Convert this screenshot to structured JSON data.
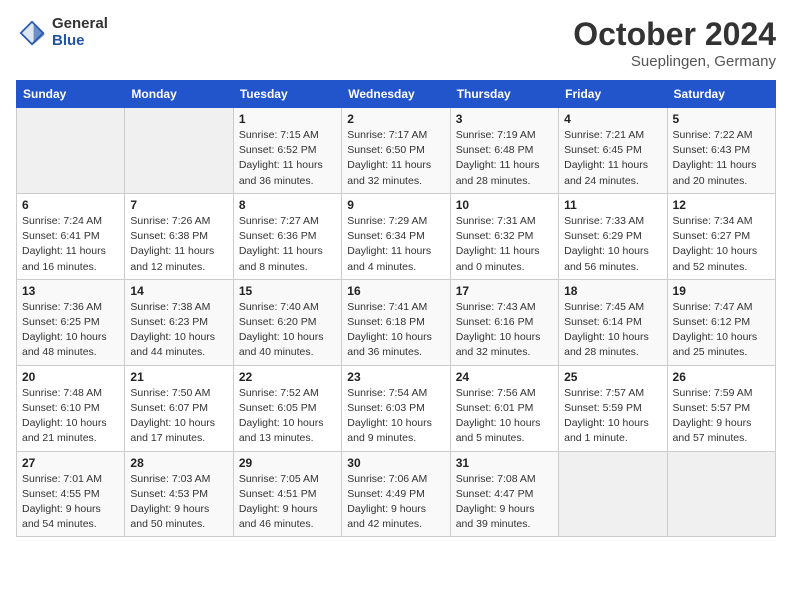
{
  "header": {
    "logo_general": "General",
    "logo_blue": "Blue",
    "month": "October 2024",
    "location": "Sueplingen, Germany"
  },
  "weekdays": [
    "Sunday",
    "Monday",
    "Tuesday",
    "Wednesday",
    "Thursday",
    "Friday",
    "Saturday"
  ],
  "weeks": [
    [
      {
        "day": "",
        "info": ""
      },
      {
        "day": "",
        "info": ""
      },
      {
        "day": "1",
        "info": "Sunrise: 7:15 AM\nSunset: 6:52 PM\nDaylight: 11 hours\nand 36 minutes."
      },
      {
        "day": "2",
        "info": "Sunrise: 7:17 AM\nSunset: 6:50 PM\nDaylight: 11 hours\nand 32 minutes."
      },
      {
        "day": "3",
        "info": "Sunrise: 7:19 AM\nSunset: 6:48 PM\nDaylight: 11 hours\nand 28 minutes."
      },
      {
        "day": "4",
        "info": "Sunrise: 7:21 AM\nSunset: 6:45 PM\nDaylight: 11 hours\nand 24 minutes."
      },
      {
        "day": "5",
        "info": "Sunrise: 7:22 AM\nSunset: 6:43 PM\nDaylight: 11 hours\nand 20 minutes."
      }
    ],
    [
      {
        "day": "6",
        "info": "Sunrise: 7:24 AM\nSunset: 6:41 PM\nDaylight: 11 hours\nand 16 minutes."
      },
      {
        "day": "7",
        "info": "Sunrise: 7:26 AM\nSunset: 6:38 PM\nDaylight: 11 hours\nand 12 minutes."
      },
      {
        "day": "8",
        "info": "Sunrise: 7:27 AM\nSunset: 6:36 PM\nDaylight: 11 hours\nand 8 minutes."
      },
      {
        "day": "9",
        "info": "Sunrise: 7:29 AM\nSunset: 6:34 PM\nDaylight: 11 hours\nand 4 minutes."
      },
      {
        "day": "10",
        "info": "Sunrise: 7:31 AM\nSunset: 6:32 PM\nDaylight: 11 hours\nand 0 minutes."
      },
      {
        "day": "11",
        "info": "Sunrise: 7:33 AM\nSunset: 6:29 PM\nDaylight: 10 hours\nand 56 minutes."
      },
      {
        "day": "12",
        "info": "Sunrise: 7:34 AM\nSunset: 6:27 PM\nDaylight: 10 hours\nand 52 minutes."
      }
    ],
    [
      {
        "day": "13",
        "info": "Sunrise: 7:36 AM\nSunset: 6:25 PM\nDaylight: 10 hours\nand 48 minutes."
      },
      {
        "day": "14",
        "info": "Sunrise: 7:38 AM\nSunset: 6:23 PM\nDaylight: 10 hours\nand 44 minutes."
      },
      {
        "day": "15",
        "info": "Sunrise: 7:40 AM\nSunset: 6:20 PM\nDaylight: 10 hours\nand 40 minutes."
      },
      {
        "day": "16",
        "info": "Sunrise: 7:41 AM\nSunset: 6:18 PM\nDaylight: 10 hours\nand 36 minutes."
      },
      {
        "day": "17",
        "info": "Sunrise: 7:43 AM\nSunset: 6:16 PM\nDaylight: 10 hours\nand 32 minutes."
      },
      {
        "day": "18",
        "info": "Sunrise: 7:45 AM\nSunset: 6:14 PM\nDaylight: 10 hours\nand 28 minutes."
      },
      {
        "day": "19",
        "info": "Sunrise: 7:47 AM\nSunset: 6:12 PM\nDaylight: 10 hours\nand 25 minutes."
      }
    ],
    [
      {
        "day": "20",
        "info": "Sunrise: 7:48 AM\nSunset: 6:10 PM\nDaylight: 10 hours\nand 21 minutes."
      },
      {
        "day": "21",
        "info": "Sunrise: 7:50 AM\nSunset: 6:07 PM\nDaylight: 10 hours\nand 17 minutes."
      },
      {
        "day": "22",
        "info": "Sunrise: 7:52 AM\nSunset: 6:05 PM\nDaylight: 10 hours\nand 13 minutes."
      },
      {
        "day": "23",
        "info": "Sunrise: 7:54 AM\nSunset: 6:03 PM\nDaylight: 10 hours\nand 9 minutes."
      },
      {
        "day": "24",
        "info": "Sunrise: 7:56 AM\nSunset: 6:01 PM\nDaylight: 10 hours\nand 5 minutes."
      },
      {
        "day": "25",
        "info": "Sunrise: 7:57 AM\nSunset: 5:59 PM\nDaylight: 10 hours\nand 1 minute."
      },
      {
        "day": "26",
        "info": "Sunrise: 7:59 AM\nSunset: 5:57 PM\nDaylight: 9 hours\nand 57 minutes."
      }
    ],
    [
      {
        "day": "27",
        "info": "Sunrise: 7:01 AM\nSunset: 4:55 PM\nDaylight: 9 hours\nand 54 minutes."
      },
      {
        "day": "28",
        "info": "Sunrise: 7:03 AM\nSunset: 4:53 PM\nDaylight: 9 hours\nand 50 minutes."
      },
      {
        "day": "29",
        "info": "Sunrise: 7:05 AM\nSunset: 4:51 PM\nDaylight: 9 hours\nand 46 minutes."
      },
      {
        "day": "30",
        "info": "Sunrise: 7:06 AM\nSunset: 4:49 PM\nDaylight: 9 hours\nand 42 minutes."
      },
      {
        "day": "31",
        "info": "Sunrise: 7:08 AM\nSunset: 4:47 PM\nDaylight: 9 hours\nand 39 minutes."
      },
      {
        "day": "",
        "info": ""
      },
      {
        "day": "",
        "info": ""
      }
    ]
  ]
}
